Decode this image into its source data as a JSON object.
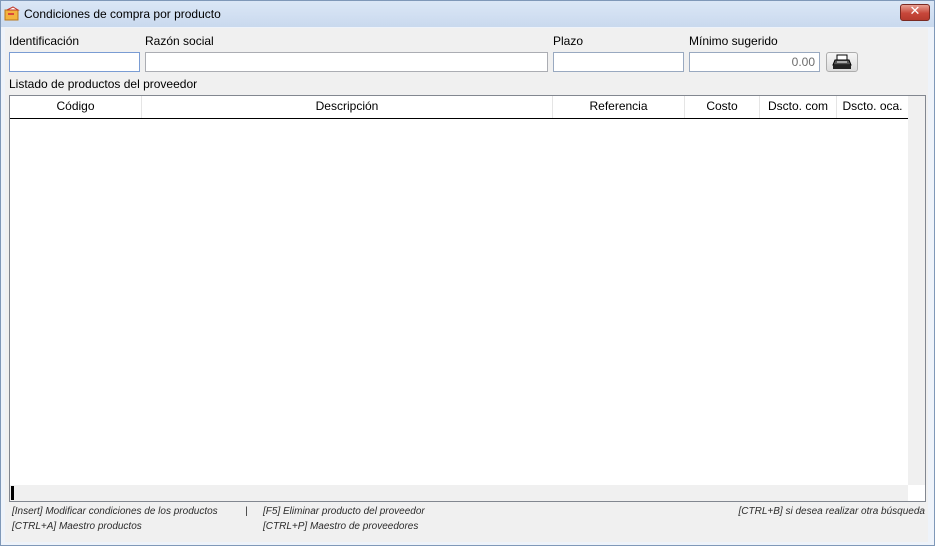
{
  "window": {
    "title": "Condiciones de compra por producto",
    "close_symbol": "✕"
  },
  "form": {
    "identificacion_label": "Identificación",
    "identificacion_value": "",
    "razon_social_label": "Razón social",
    "razon_social_value": "",
    "plazo_label": "Plazo",
    "plazo_value": "",
    "minimo_label": "Mínimo sugerido",
    "minimo_value": "0.00",
    "print_icon": "printer-icon"
  },
  "grid": {
    "caption": "Listado de productos del proveedor",
    "columns": [
      "Código",
      "Descripción",
      "Referencia",
      "Costo",
      "Dscto. com",
      "Dscto. oca."
    ],
    "rows": []
  },
  "footer": {
    "insert_hint": "[Insert] Modificar condiciones de los productos",
    "separator": "|",
    "ctrl_a_hint": "[CTRL+A] Maestro productos",
    "f5_hint": "[F5] Eliminar producto del proveedor",
    "ctrl_p_hint": "[CTRL+P] Maestro de proveedores",
    "ctrl_b_hint": "[CTRL+B] si desea realizar otra búsqueda"
  }
}
